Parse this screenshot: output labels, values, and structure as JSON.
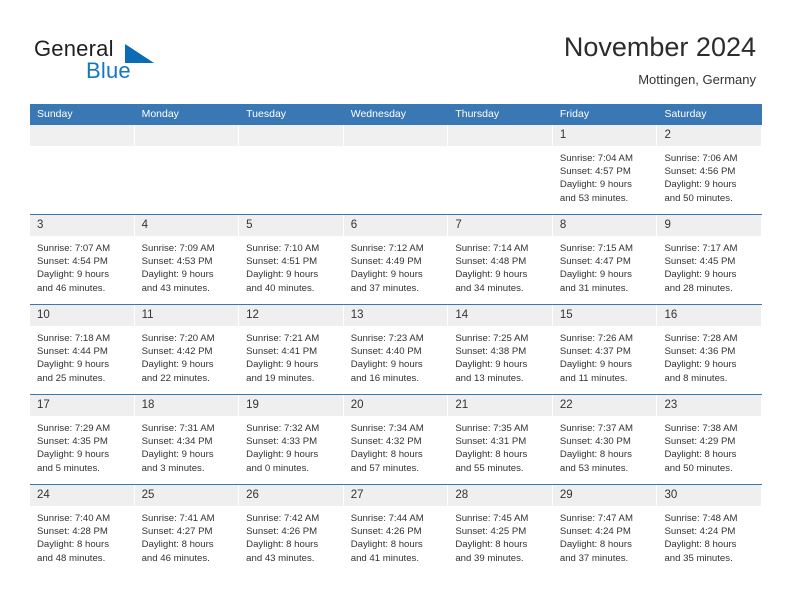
{
  "brand": {
    "word1": "General",
    "word2": "Blue",
    "triangle_color": "#0b6cb3",
    "blue_text_color": "#1577c1"
  },
  "header": {
    "title": "November 2024",
    "subtitle": "Mottingen, Germany"
  },
  "theme": {
    "header_blue": "#3a78b5",
    "daynum_strip": "#efefef",
    "text": "#333333"
  },
  "weekdays": [
    "Sunday",
    "Monday",
    "Tuesday",
    "Wednesday",
    "Thursday",
    "Friday",
    "Saturday"
  ],
  "weeks": [
    [
      {
        "day": "",
        "lines": []
      },
      {
        "day": "",
        "lines": []
      },
      {
        "day": "",
        "lines": []
      },
      {
        "day": "",
        "lines": []
      },
      {
        "day": "",
        "lines": []
      },
      {
        "day": "1",
        "lines": [
          "Sunrise: 7:04 AM",
          "Sunset: 4:57 PM",
          "Daylight: 9 hours",
          "and 53 minutes."
        ]
      },
      {
        "day": "2",
        "lines": [
          "Sunrise: 7:06 AM",
          "Sunset: 4:56 PM",
          "Daylight: 9 hours",
          "and 50 minutes."
        ]
      }
    ],
    [
      {
        "day": "3",
        "lines": [
          "Sunrise: 7:07 AM",
          "Sunset: 4:54 PM",
          "Daylight: 9 hours",
          "and 46 minutes."
        ]
      },
      {
        "day": "4",
        "lines": [
          "Sunrise: 7:09 AM",
          "Sunset: 4:53 PM",
          "Daylight: 9 hours",
          "and 43 minutes."
        ]
      },
      {
        "day": "5",
        "lines": [
          "Sunrise: 7:10 AM",
          "Sunset: 4:51 PM",
          "Daylight: 9 hours",
          "and 40 minutes."
        ]
      },
      {
        "day": "6",
        "lines": [
          "Sunrise: 7:12 AM",
          "Sunset: 4:49 PM",
          "Daylight: 9 hours",
          "and 37 minutes."
        ]
      },
      {
        "day": "7",
        "lines": [
          "Sunrise: 7:14 AM",
          "Sunset: 4:48 PM",
          "Daylight: 9 hours",
          "and 34 minutes."
        ]
      },
      {
        "day": "8",
        "lines": [
          "Sunrise: 7:15 AM",
          "Sunset: 4:47 PM",
          "Daylight: 9 hours",
          "and 31 minutes."
        ]
      },
      {
        "day": "9",
        "lines": [
          "Sunrise: 7:17 AM",
          "Sunset: 4:45 PM",
          "Daylight: 9 hours",
          "and 28 minutes."
        ]
      }
    ],
    [
      {
        "day": "10",
        "lines": [
          "Sunrise: 7:18 AM",
          "Sunset: 4:44 PM",
          "Daylight: 9 hours",
          "and 25 minutes."
        ]
      },
      {
        "day": "11",
        "lines": [
          "Sunrise: 7:20 AM",
          "Sunset: 4:42 PM",
          "Daylight: 9 hours",
          "and 22 minutes."
        ]
      },
      {
        "day": "12",
        "lines": [
          "Sunrise: 7:21 AM",
          "Sunset: 4:41 PM",
          "Daylight: 9 hours",
          "and 19 minutes."
        ]
      },
      {
        "day": "13",
        "lines": [
          "Sunrise: 7:23 AM",
          "Sunset: 4:40 PM",
          "Daylight: 9 hours",
          "and 16 minutes."
        ]
      },
      {
        "day": "14",
        "lines": [
          "Sunrise: 7:25 AM",
          "Sunset: 4:38 PM",
          "Daylight: 9 hours",
          "and 13 minutes."
        ]
      },
      {
        "day": "15",
        "lines": [
          "Sunrise: 7:26 AM",
          "Sunset: 4:37 PM",
          "Daylight: 9 hours",
          "and 11 minutes."
        ]
      },
      {
        "day": "16",
        "lines": [
          "Sunrise: 7:28 AM",
          "Sunset: 4:36 PM",
          "Daylight: 9 hours",
          "and 8 minutes."
        ]
      }
    ],
    [
      {
        "day": "17",
        "lines": [
          "Sunrise: 7:29 AM",
          "Sunset: 4:35 PM",
          "Daylight: 9 hours",
          "and 5 minutes."
        ]
      },
      {
        "day": "18",
        "lines": [
          "Sunrise: 7:31 AM",
          "Sunset: 4:34 PM",
          "Daylight: 9 hours",
          "and 3 minutes."
        ]
      },
      {
        "day": "19",
        "lines": [
          "Sunrise: 7:32 AM",
          "Sunset: 4:33 PM",
          "Daylight: 9 hours",
          "and 0 minutes."
        ]
      },
      {
        "day": "20",
        "lines": [
          "Sunrise: 7:34 AM",
          "Sunset: 4:32 PM",
          "Daylight: 8 hours",
          "and 57 minutes."
        ]
      },
      {
        "day": "21",
        "lines": [
          "Sunrise: 7:35 AM",
          "Sunset: 4:31 PM",
          "Daylight: 8 hours",
          "and 55 minutes."
        ]
      },
      {
        "day": "22",
        "lines": [
          "Sunrise: 7:37 AM",
          "Sunset: 4:30 PM",
          "Daylight: 8 hours",
          "and 53 minutes."
        ]
      },
      {
        "day": "23",
        "lines": [
          "Sunrise: 7:38 AM",
          "Sunset: 4:29 PM",
          "Daylight: 8 hours",
          "and 50 minutes."
        ]
      }
    ],
    [
      {
        "day": "24",
        "lines": [
          "Sunrise: 7:40 AM",
          "Sunset: 4:28 PM",
          "Daylight: 8 hours",
          "and 48 minutes."
        ]
      },
      {
        "day": "25",
        "lines": [
          "Sunrise: 7:41 AM",
          "Sunset: 4:27 PM",
          "Daylight: 8 hours",
          "and 46 minutes."
        ]
      },
      {
        "day": "26",
        "lines": [
          "Sunrise: 7:42 AM",
          "Sunset: 4:26 PM",
          "Daylight: 8 hours",
          "and 43 minutes."
        ]
      },
      {
        "day": "27",
        "lines": [
          "Sunrise: 7:44 AM",
          "Sunset: 4:26 PM",
          "Daylight: 8 hours",
          "and 41 minutes."
        ]
      },
      {
        "day": "28",
        "lines": [
          "Sunrise: 7:45 AM",
          "Sunset: 4:25 PM",
          "Daylight: 8 hours",
          "and 39 minutes."
        ]
      },
      {
        "day": "29",
        "lines": [
          "Sunrise: 7:47 AM",
          "Sunset: 4:24 PM",
          "Daylight: 8 hours",
          "and 37 minutes."
        ]
      },
      {
        "day": "30",
        "lines": [
          "Sunrise: 7:48 AM",
          "Sunset: 4:24 PM",
          "Daylight: 8 hours",
          "and 35 minutes."
        ]
      }
    ]
  ]
}
